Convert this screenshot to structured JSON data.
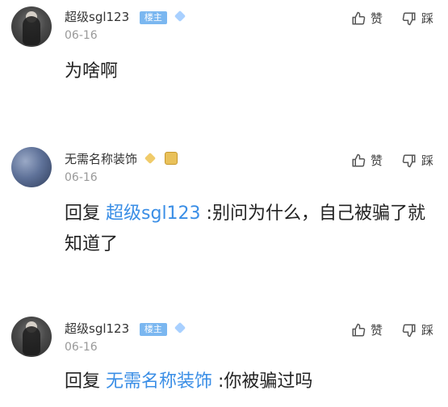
{
  "comments": [
    {
      "user": "超级sgl123",
      "badge": "楼主",
      "time": "06-16",
      "like_label": "赞",
      "dislike_label": "踩",
      "content": "为啥啊"
    },
    {
      "user": "无需名称装饰",
      "time": "06-16",
      "like_label": "赞",
      "dislike_label": "踩",
      "reply_prefix": "回复",
      "mention": "超级sgl123",
      "content": " :别问为什么，自己被骗了就知道了"
    },
    {
      "user": "超级sgl123",
      "badge": "楼主",
      "time": "06-16",
      "like_label": "赞",
      "dislike_label": "踩",
      "reply_prefix": "回复",
      "mention": "无需名称装饰",
      "content": " :你被骗过吗"
    }
  ],
  "colors": {
    "mention": "#3a8ee6",
    "badge": "#7bb7f0",
    "time": "#999999"
  }
}
